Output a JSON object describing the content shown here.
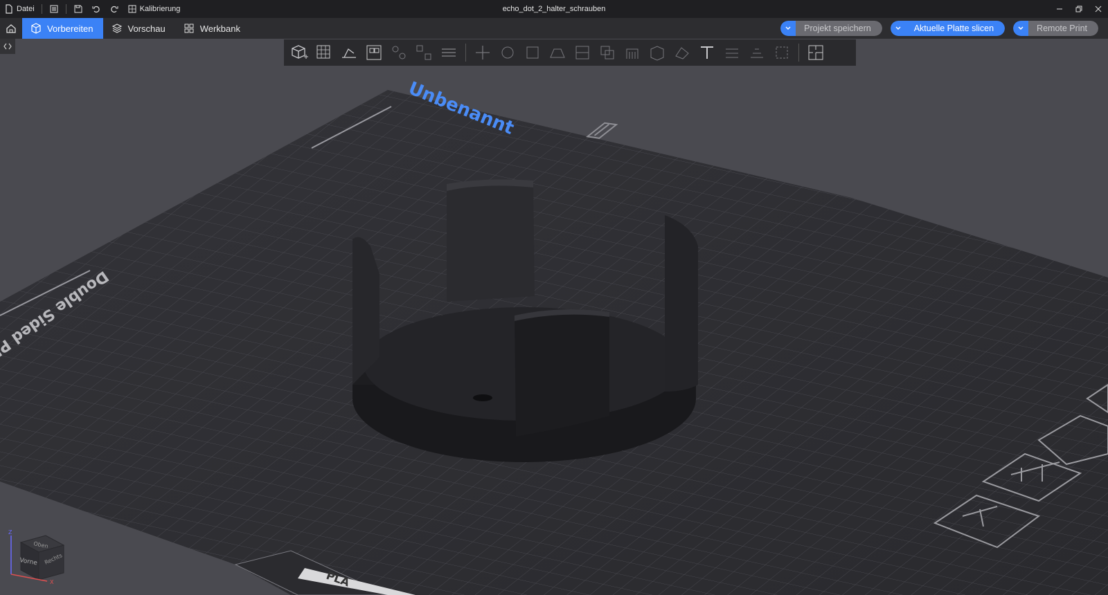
{
  "titlebar": {
    "menu_file": "Datei",
    "calibration": "Kalibrierung",
    "window_title": "echo_dot_2_halter_schrauben"
  },
  "navbar": {
    "tabs": [
      {
        "label": "Vorbereiten",
        "active": true
      },
      {
        "label": "Vorschau",
        "active": false
      },
      {
        "label": "Werkbank",
        "active": false
      }
    ],
    "actions": {
      "save_project": "Projekt speichern",
      "slice_plate": "Aktuelle Platte slicen",
      "remote_print": "Remote Print"
    }
  },
  "plate": {
    "name": "Unbenannt",
    "sheet_label": "Double Sided PEI Sheet",
    "filament_tab": "PLA"
  },
  "view_cube": {
    "top": "Oben",
    "front": "Vorne",
    "right": "Rechts",
    "axis_z": "Z",
    "axis_x": "X"
  },
  "colors": {
    "accent": "#3b82f6",
    "background": "#4a4a50",
    "bed": "#2b2b2f",
    "model": "#222226"
  }
}
